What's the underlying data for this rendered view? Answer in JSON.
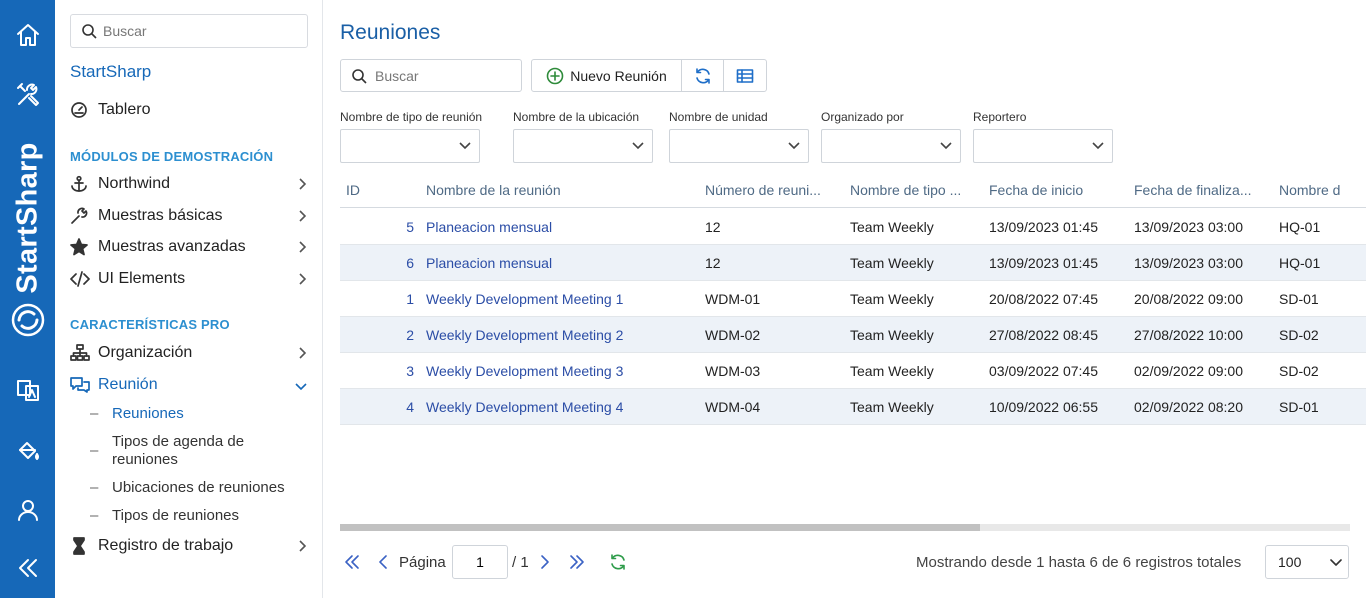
{
  "rail": {
    "brand": "StartSharp"
  },
  "sidebar": {
    "search_placeholder": "Buscar",
    "app_name": "StartSharp",
    "dashboard": "Tablero",
    "section_demo": "MÓDULOS DE DEMOSTRACIÓN",
    "demo_items": [
      "Northwind",
      "Muestras básicas",
      "Muestras avanzadas",
      "UI Elements"
    ],
    "section_pro": "CARACTERÍSTICAS PRO",
    "pro_items": [
      "Organización",
      "Reunión"
    ],
    "sub_items": [
      "Reuniones",
      "Tipos de agenda de reuniones",
      "Ubicaciones de reuniones",
      "Tipos de reuniones"
    ],
    "dash": "–",
    "worklog": "Registro de trabajo"
  },
  "main": {
    "title": "Reuniones",
    "search_placeholder": "Buscar",
    "new_button": "Nuevo Reunión",
    "filters": [
      "Nombre de tipo de reunión",
      "Nombre de la ubicación",
      "Nombre de unidad",
      "Organizado por",
      "Reportero"
    ],
    "columns": [
      "ID",
      "Nombre de la reunión",
      "Número de reuni...",
      "Nombre de tipo ...",
      "Fecha de inicio",
      "Fecha de finaliza...",
      "Nombre d"
    ],
    "rows": [
      [
        "5",
        "Planeacion mensual",
        "12",
        "Team Weekly",
        "13/09/2023 01:45",
        "13/09/2023 03:00",
        "HQ-01"
      ],
      [
        "6",
        "Planeacion mensual",
        "12",
        "Team Weekly",
        "13/09/2023 01:45",
        "13/09/2023 03:00",
        "HQ-01"
      ],
      [
        "1",
        "Weekly Development Meeting 1",
        "WDM-01",
        "Team Weekly",
        "20/08/2022 07:45",
        "20/08/2022 09:00",
        "SD-01"
      ],
      [
        "2",
        "Weekly Development Meeting 2",
        "WDM-02",
        "Team Weekly",
        "27/08/2022 08:45",
        "27/08/2022 10:00",
        "SD-02"
      ],
      [
        "3",
        "Weekly Development Meeting 3",
        "WDM-03",
        "Team Weekly",
        "03/09/2022 07:45",
        "02/09/2022 09:00",
        "SD-02"
      ],
      [
        "4",
        "Weekly Development Meeting 4",
        "WDM-04",
        "Team Weekly",
        "10/09/2022 06:55",
        "02/09/2022 08:20",
        "SD-01"
      ]
    ],
    "pager": {
      "page_label": "Página",
      "page_value": "1",
      "page_total": "/ 1",
      "info": "Mostrando desde 1 hasta 6 de 6 registros totales",
      "page_size": "100"
    }
  },
  "colors": {
    "brand": "#1668b8",
    "link": "#2b4da6",
    "accent": "#2c8fd0",
    "row_alt": "#edf2f8"
  }
}
